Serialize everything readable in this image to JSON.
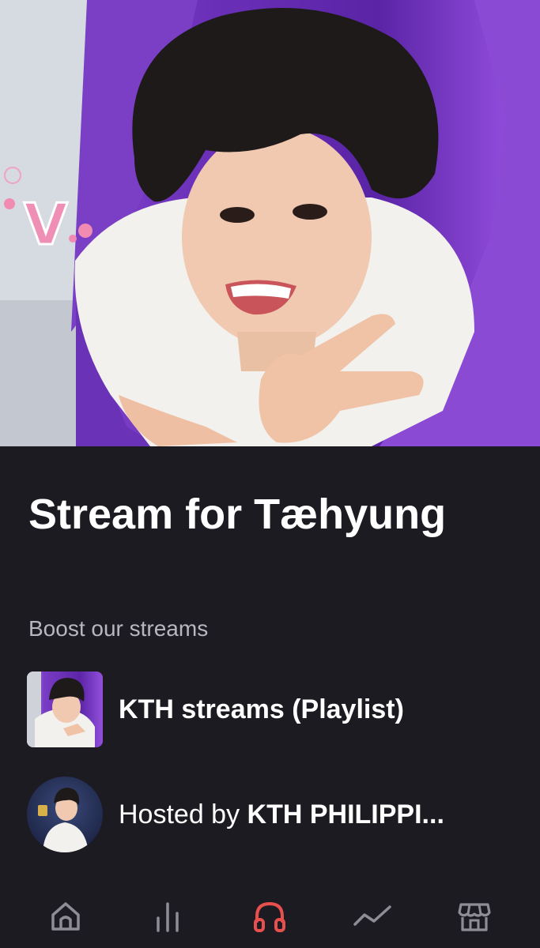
{
  "hero": {
    "badge_text": "V",
    "image_description_icon": "person-photo"
  },
  "content": {
    "title": "Stream for Tæhyung",
    "subtitle": "Boost our streams"
  },
  "playlist_row": {
    "label": "KTH streams (Playlist)"
  },
  "host_row": {
    "prefix": "Hosted by ",
    "name": "KTH PHILIPPI..."
  },
  "bottom_nav": {
    "active_index": 2,
    "accent_color": "#e8504d",
    "inactive_color": "#8e8d96",
    "items": [
      {
        "icon": "home-icon"
      },
      {
        "icon": "chart-bars-icon"
      },
      {
        "icon": "headphones-icon"
      },
      {
        "icon": "trending-icon"
      },
      {
        "icon": "store-icon"
      }
    ]
  }
}
